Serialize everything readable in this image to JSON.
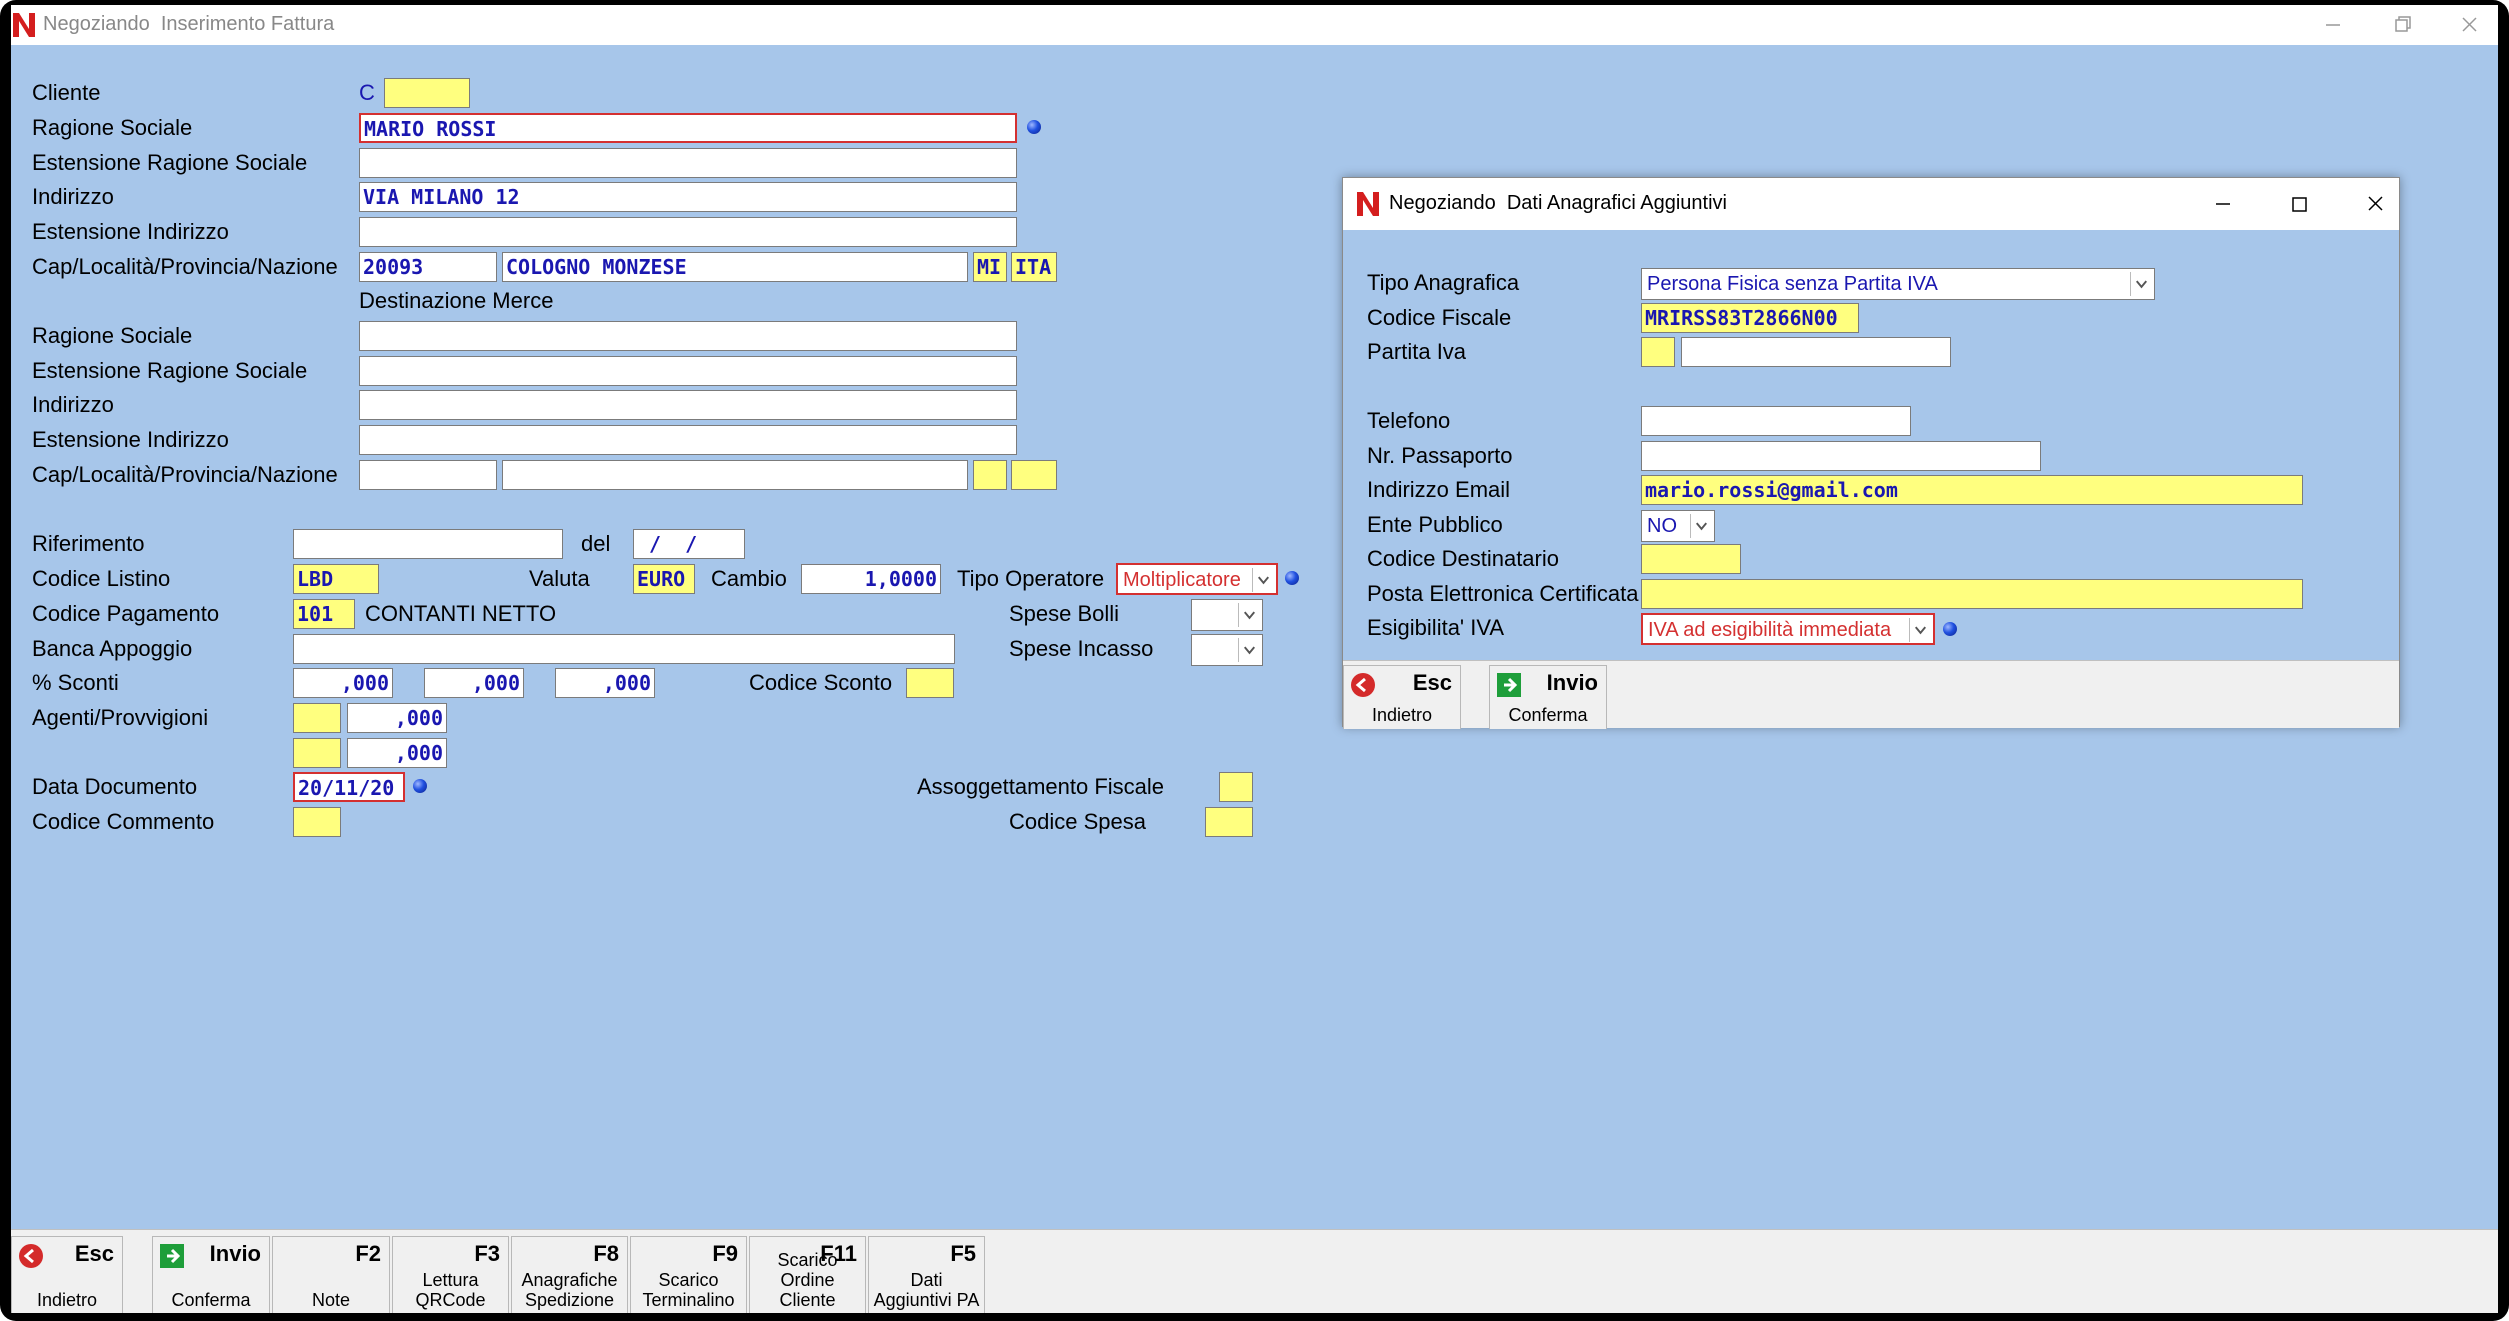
{
  "window": {
    "title": "Negoziando  Inserimento Fattura"
  },
  "form": {
    "cliente": {
      "label": "Cliente",
      "prefix": "C",
      "value": ""
    },
    "ragione_sociale": {
      "label": "Ragione Sociale",
      "value": "MARIO ROSSI"
    },
    "est_ragione_sociale": {
      "label": "Estensione Ragione Sociale",
      "value": ""
    },
    "indirizzo": {
      "label": "Indirizzo",
      "value": "VIA MILANO 12"
    },
    "est_indirizzo": {
      "label": "Estensione Indirizzo",
      "value": ""
    },
    "cap_loc": {
      "label": "Cap/Località/Provincia/Nazione",
      "cap": "20093",
      "localita": "COLOGNO MONZESE",
      "provincia": "MI",
      "nazione": "ITA"
    },
    "destinazione_merce": "Destinazione Merce",
    "dest_ragione_sociale": {
      "label": "Ragione Sociale",
      "value": ""
    },
    "dest_est_ragione_sociale": {
      "label": "Estensione Ragione Sociale",
      "value": ""
    },
    "dest_indirizzo": {
      "label": "Indirizzo",
      "value": ""
    },
    "dest_est_indirizzo": {
      "label": "Estensione Indirizzo",
      "value": ""
    },
    "dest_cap_loc": {
      "label": "Cap/Località/Provincia/Nazione",
      "cap": "",
      "localita": "",
      "provincia": "",
      "nazione": ""
    },
    "riferimento": {
      "label": "Riferimento",
      "value": "",
      "del_label": "del",
      "del_value": " /  /"
    },
    "codice_listino": {
      "label": "Codice Listino",
      "value": "LBD"
    },
    "valuta": {
      "label": "Valuta",
      "value": "EURO"
    },
    "cambio": {
      "label": "Cambio",
      "value": "1,0000"
    },
    "tipo_operatore": {
      "label": "Tipo Operatore",
      "value": "Moltiplicatore"
    },
    "codice_pagamento": {
      "label": "Codice Pagamento",
      "value": "101",
      "description": "CONTANTI NETTO"
    },
    "spese_bolli": {
      "label": "Spese Bolli",
      "value": ""
    },
    "banca_appoggio": {
      "label": "Banca Appoggio",
      "value": ""
    },
    "spese_incasso": {
      "label": "Spese Incasso",
      "value": ""
    },
    "sconti": {
      "label": "% Sconti",
      "values": [
        ",000",
        ",000",
        ",000"
      ]
    },
    "codice_sconto": {
      "label": "Codice Sconto",
      "value": ""
    },
    "agenti": {
      "label": "Agenti/Provvigioni",
      "rows": [
        {
          "code": "",
          "value": ",000"
        },
        {
          "code": "",
          "value": ",000"
        }
      ]
    },
    "data_documento": {
      "label": "Data Documento",
      "value": "20/11/20"
    },
    "assoggettamento": {
      "label": "Assoggettamento Fiscale",
      "value": ""
    },
    "codice_commento": {
      "label": "Codice Commento",
      "value": ""
    },
    "codice_spesa": {
      "label": "Codice Spesa",
      "value": ""
    }
  },
  "toolbar": [
    {
      "key": "Esc",
      "desc": "Indietro"
    },
    {
      "key": "Invio",
      "desc": "Conferma"
    },
    {
      "key": "F2",
      "desc": "Note"
    },
    {
      "key": "F3",
      "desc1": "Lettura",
      "desc2": "QRCode"
    },
    {
      "key": "F8",
      "desc1": "Anagrafiche",
      "desc2": "Spedizione"
    },
    {
      "key": "F9",
      "desc1": "Scarico",
      "desc2": "Terminalino"
    },
    {
      "key": "F11",
      "desc1": "Scarico",
      "desc2": "Ordine Cliente"
    },
    {
      "key": "F5",
      "desc1": "Dati",
      "desc2": "Aggiuntivi PA"
    }
  ],
  "dialog": {
    "title": "Negoziando  Dati Anagrafici Aggiuntivi",
    "tipo_anagrafica": {
      "label": "Tipo Anagrafica",
      "value": "Persona Fisica senza Partita IVA"
    },
    "codice_fiscale": {
      "label": "Codice Fiscale",
      "value": "MRIRSS83T2866N00"
    },
    "partita_iva": {
      "label": "Partita Iva",
      "prefix": "",
      "value": ""
    },
    "telefono": {
      "label": "Telefono",
      "value": ""
    },
    "passaporto": {
      "label": "Nr. Passaporto",
      "value": ""
    },
    "email": {
      "label": "Indirizzo Email",
      "value": "mario.rossi@gmail.com"
    },
    "ente_pubblico": {
      "label": "Ente Pubblico",
      "value": "NO"
    },
    "codice_destinatario": {
      "label": "Codice Destinatario",
      "value": ""
    },
    "pec": {
      "label": "Posta Elettronica Certificata",
      "value": ""
    },
    "esigibilita": {
      "label": "Esigibilita' IVA",
      "value": "IVA ad esigibilità immediata"
    },
    "buttons": [
      {
        "key": "Esc",
        "desc": "Indietro"
      },
      {
        "key": "Invio",
        "desc": "Conferma"
      }
    ]
  },
  "colors": {
    "background": "#a7c6ea",
    "field_yellow": "#ffff7f",
    "field_text": "#1a17b0",
    "required_border": "#d43030"
  }
}
